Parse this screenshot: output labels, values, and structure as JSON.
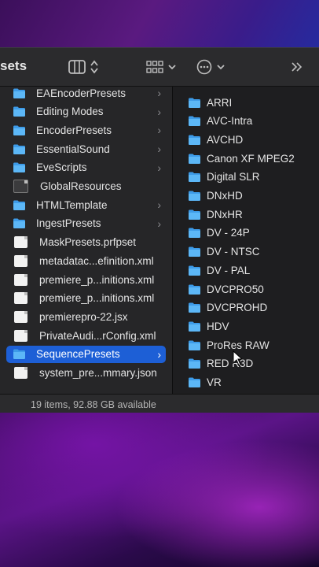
{
  "window": {
    "title": "sets",
    "status": "19 items, 92.88 GB available"
  },
  "toolbar": {
    "view_icon": "column-view-icon",
    "group_icon": "grid-group-icon",
    "action_icon": "ellipsis-circle-icon",
    "more_icon": "double-chevron-right-icon"
  },
  "left_items": [
    {
      "label": "EAEncoderPresets",
      "icon": "folder-icon",
      "chevron": true
    },
    {
      "label": "Editing Modes",
      "icon": "folder-icon",
      "chevron": true
    },
    {
      "label": "EncoderPresets",
      "icon": "folder-icon",
      "chevron": true
    },
    {
      "label": "EssentialSound",
      "icon": "folder-icon",
      "chevron": true
    },
    {
      "label": "EveScripts",
      "icon": "folder-icon",
      "chevron": true
    },
    {
      "label": "GlobalResources",
      "icon": "dark-document-icon",
      "chevron": false
    },
    {
      "label": "HTMLTemplate",
      "icon": "folder-icon",
      "chevron": true
    },
    {
      "label": "IngestPresets",
      "icon": "folder-icon",
      "chevron": true
    },
    {
      "label": "MaskPresets.prfpset",
      "icon": "document-icon",
      "chevron": false
    },
    {
      "label": "metadatac...efinition.xml",
      "icon": "document-icon",
      "chevron": false
    },
    {
      "label": "premiere_p...initions.xml",
      "icon": "document-icon",
      "chevron": false
    },
    {
      "label": "premiere_p...initions.xml",
      "icon": "document-icon",
      "chevron": false
    },
    {
      "label": "premierepro-22.jsx",
      "icon": "script-icon",
      "chevron": false
    },
    {
      "label": "PrivateAudi...rConfig.xml",
      "icon": "document-icon",
      "chevron": false
    },
    {
      "label": "SequencePresets",
      "icon": "folder-icon",
      "chevron": true,
      "selected": true
    },
    {
      "label": "system_pre...mmary.json",
      "icon": "document-icon",
      "chevron": false
    }
  ],
  "right_items": [
    "ARRI",
    "AVC-Intra",
    "AVCHD",
    "Canon XF MPEG2",
    "Digital SLR",
    "DNxHD",
    "DNxHR",
    "DV - 24P",
    "DV - NTSC",
    "DV - PAL",
    "DVCPRO50",
    "DVCPROHD",
    "HDV",
    "ProRes RAW",
    "RED R3D",
    "VR"
  ],
  "colors": {
    "selection": "#1d5fd6",
    "folder": "#4aaef2"
  }
}
